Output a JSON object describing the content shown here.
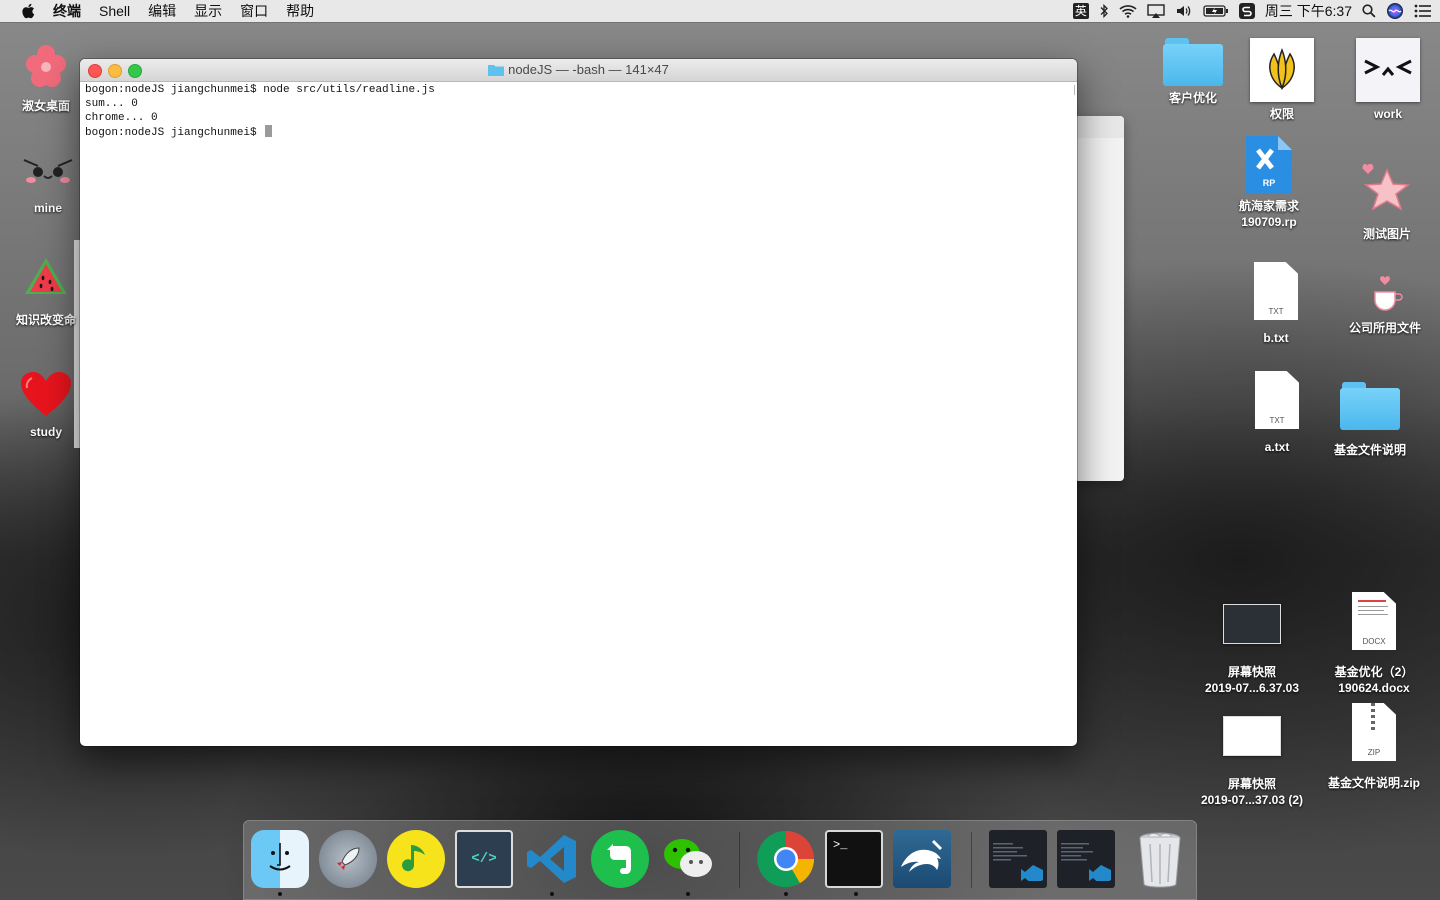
{
  "menubar": {
    "app_name": "终端",
    "items": [
      "Shell",
      "编辑",
      "显示",
      "窗口",
      "帮助"
    ],
    "input_method": "英",
    "clock": "周三 下午6:37"
  },
  "terminal": {
    "title": "nodeJS — -bash — 141×47",
    "lines": [
      "bogon:nodeJS jiangchunmei$ node src/utils/readline.js",
      "sum... 0",
      "chrome... 0"
    ],
    "prompt": "bogon:nodeJS jiangchunmei$ "
  },
  "desktop_left": [
    {
      "label": "淑女桌面",
      "icon": "flower-icon"
    },
    {
      "label": "mine",
      "icon": "face-icon"
    },
    {
      "label": "知识改变命",
      "icon": "watermelon-icon"
    },
    {
      "label": "study",
      "icon": "heart-icon"
    }
  ],
  "desktop_right": {
    "kehu": "客户优化",
    "quanxian": "权限",
    "work": "work",
    "rp_line1": "航海家需求",
    "rp_line2": "190709.rp",
    "rp_badge": "RP",
    "ceshi": "测试图片",
    "btxt": "b.txt",
    "gongsi": "公司所用文件",
    "atxt": "a.txt",
    "jijin": "基金文件说明",
    "shot1_line1": "屏幕快照",
    "shot1_line2": "2019-07...6.37.03",
    "docx_line1": "基金优化（2）",
    "docx_line2": "190624.docx",
    "shot2_line1": "屏幕快照",
    "shot2_line2": "2019-07...37.03 (2)",
    "zip": "基金文件说明.zip",
    "txt_ext": "TXT",
    "docx_ext": "DOCX",
    "zip_ext": "ZIP"
  },
  "dock": {
    "apps": [
      "finder-icon",
      "launchpad-icon",
      "music-icon",
      "code-editor-icon",
      "vscode-icon",
      "evernote-icon",
      "wechat-icon",
      "chrome-icon",
      "terminal-icon",
      "mysql-workbench-icon",
      "window-thumb-icon",
      "window-thumb-icon",
      "trash-icon"
    ],
    "code_glyph": "</>",
    "terminal_glyph": ">_"
  },
  "colors": {
    "close": "#fc5753",
    "minimize": "#fdbc40",
    "zoom": "#34c84a",
    "folder": "#5ec2f1",
    "vscode": "#2489ca",
    "chrome_red": "#db4437"
  }
}
